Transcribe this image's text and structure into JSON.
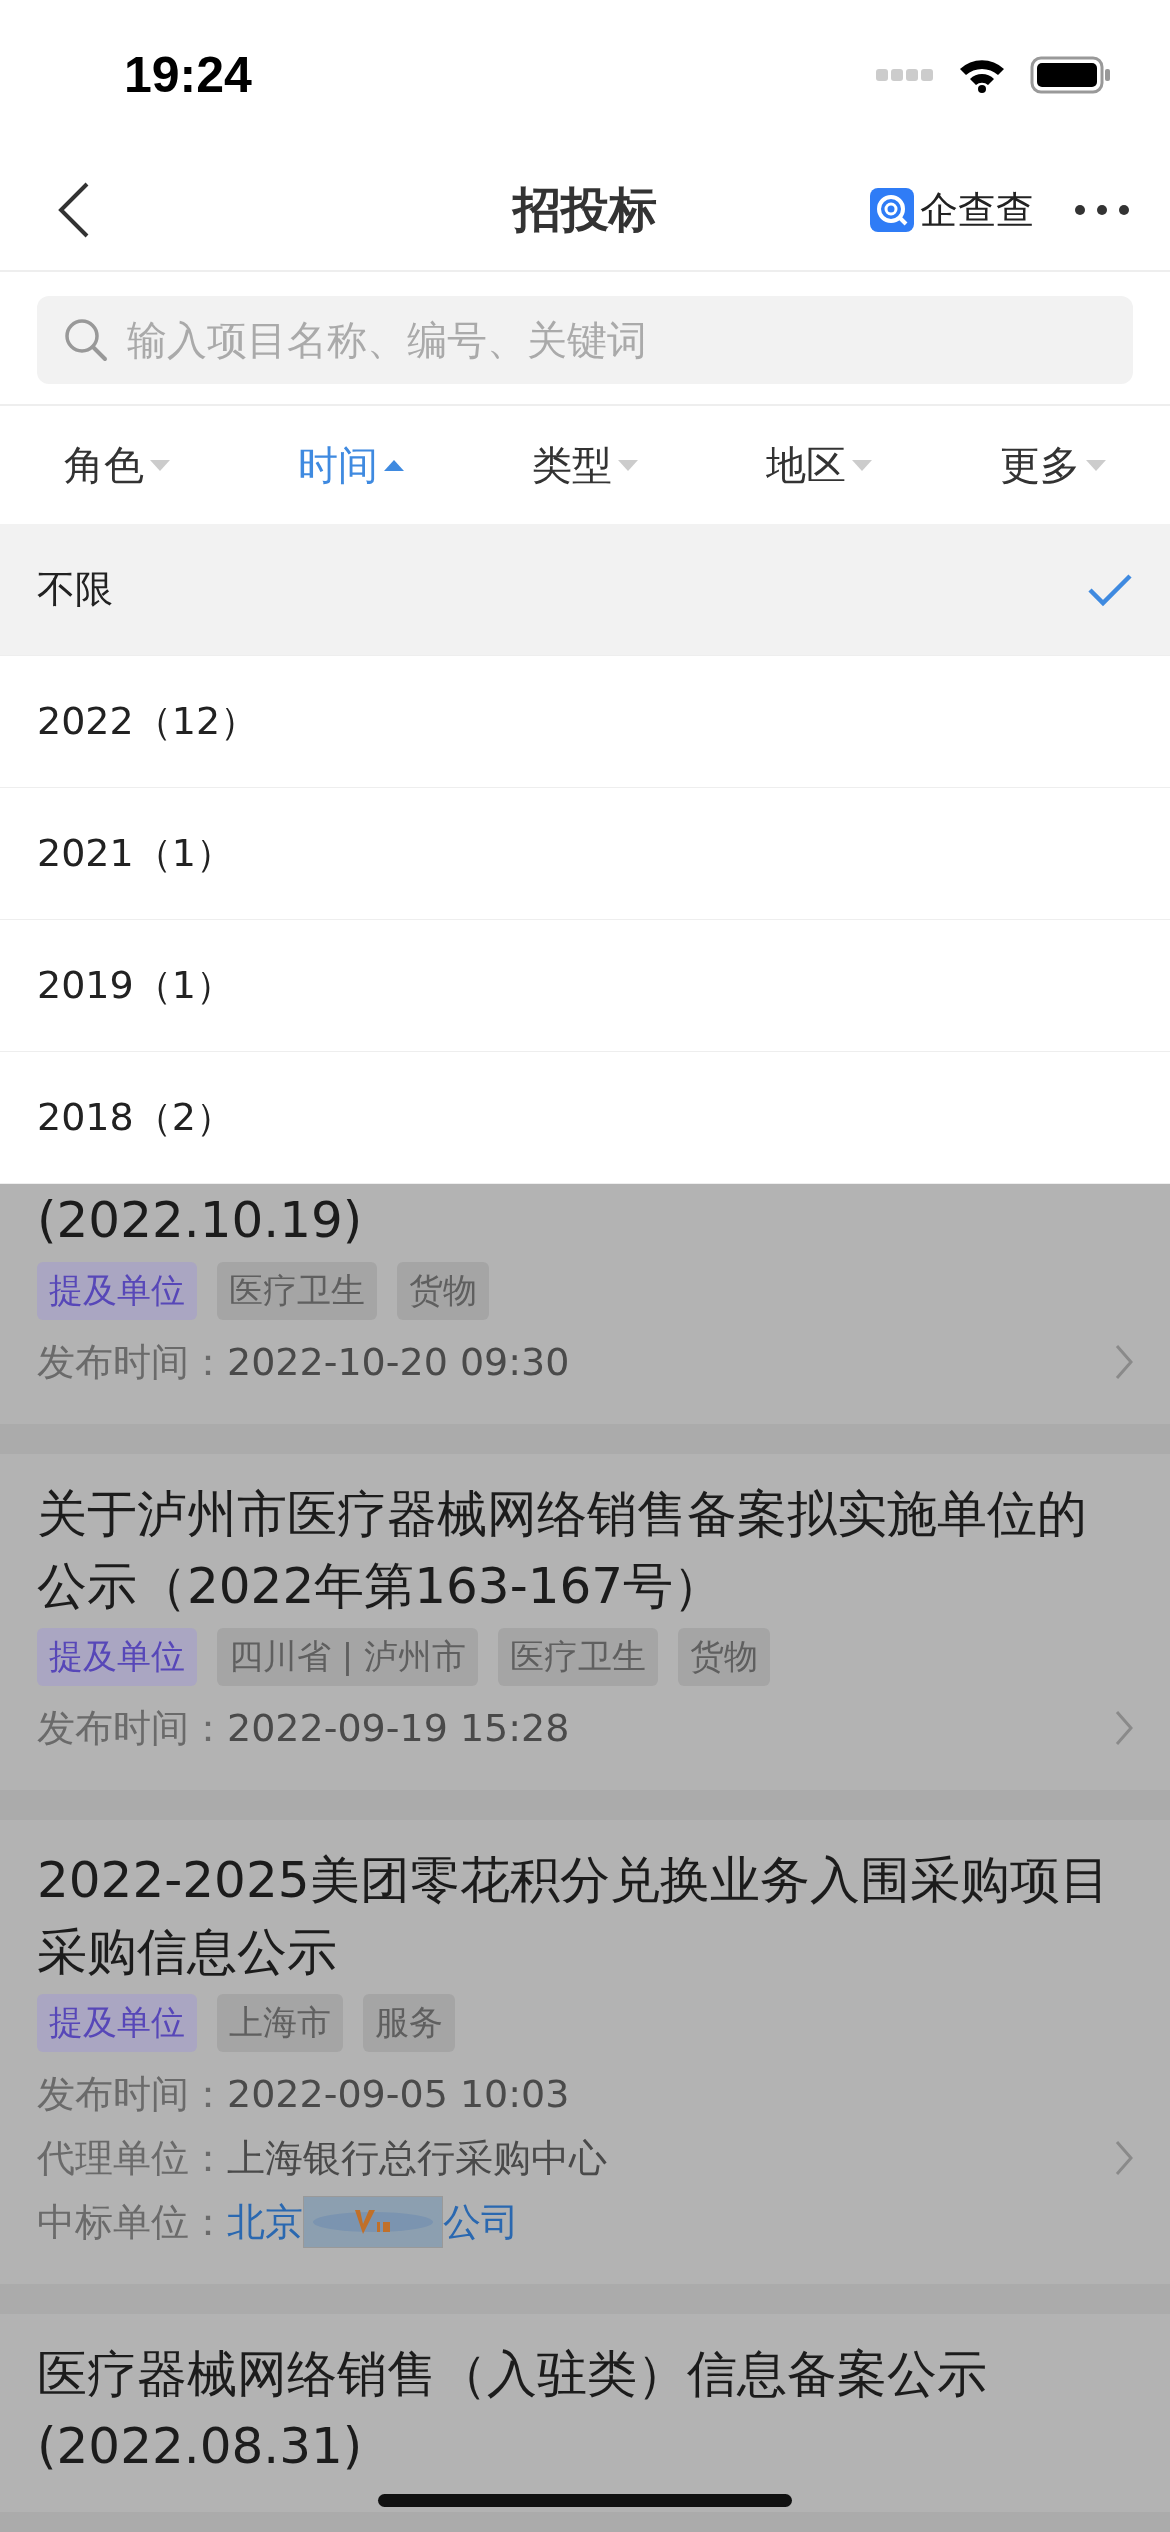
{
  "status_bar": {
    "time": "19:24"
  },
  "nav": {
    "title": "招投标",
    "brand": "企查查"
  },
  "search": {
    "placeholder": "输入项目名称、编号、关键词"
  },
  "filters": [
    {
      "label": "角色",
      "selected": false
    },
    {
      "label": "时间",
      "selected": true
    },
    {
      "label": "类型",
      "selected": false
    },
    {
      "label": "地区",
      "selected": false
    },
    {
      "label": "更多",
      "selected": false
    }
  ],
  "dropdown": [
    {
      "label": "不限",
      "selected": true
    },
    {
      "label": "2022（12）",
      "selected": false
    },
    {
      "label": "2021（1）",
      "selected": false
    },
    {
      "label": "2019（1）",
      "selected": false
    },
    {
      "label": "2018（2）",
      "selected": false
    }
  ],
  "results": [
    {
      "title": "(2022.10.19)",
      "tags": [
        {
          "label": "提及单位",
          "kind": "mention"
        },
        {
          "label": "医疗卫生",
          "kind": "category"
        },
        {
          "label": "货物",
          "kind": "category"
        }
      ],
      "fields": [
        {
          "label": "发布时间：",
          "kind": "text",
          "value": "2022-10-20 09:30"
        }
      ]
    },
    {
      "title": "关于泸州市医疗器械网络销售备案拟实施单位的公示（2022年第163-167号）",
      "tags": [
        {
          "label": "提及单位",
          "kind": "mention"
        },
        {
          "label": "四川省 | 泸州市",
          "kind": "category"
        },
        {
          "label": "医疗卫生",
          "kind": "category"
        },
        {
          "label": "货物",
          "kind": "category"
        }
      ],
      "fields": [
        {
          "label": "发布时间：",
          "kind": "text",
          "value": "2022-09-19 15:28"
        }
      ]
    },
    {
      "title": "2022-2025美团零花积分兑换业务入围采购项目采购信息公示",
      "tags": [
        {
          "label": "提及单位",
          "kind": "mention"
        },
        {
          "label": "上海市",
          "kind": "category"
        },
        {
          "label": "服务",
          "kind": "category"
        }
      ],
      "fields": [
        {
          "label": "发布时间：",
          "kind": "text",
          "value": "2022-09-05 10:03"
        },
        {
          "label": "代理单位：",
          "kind": "text",
          "value": "上海银行总行采购中心"
        },
        {
          "label": "中标单位：",
          "kind": "redacted_link",
          "parts": [
            "北京",
            "公司"
          ]
        }
      ]
    },
    {
      "title": "医疗器械网络销售（入驻类）信息备案公示(2022.08.31)"
    }
  ]
}
